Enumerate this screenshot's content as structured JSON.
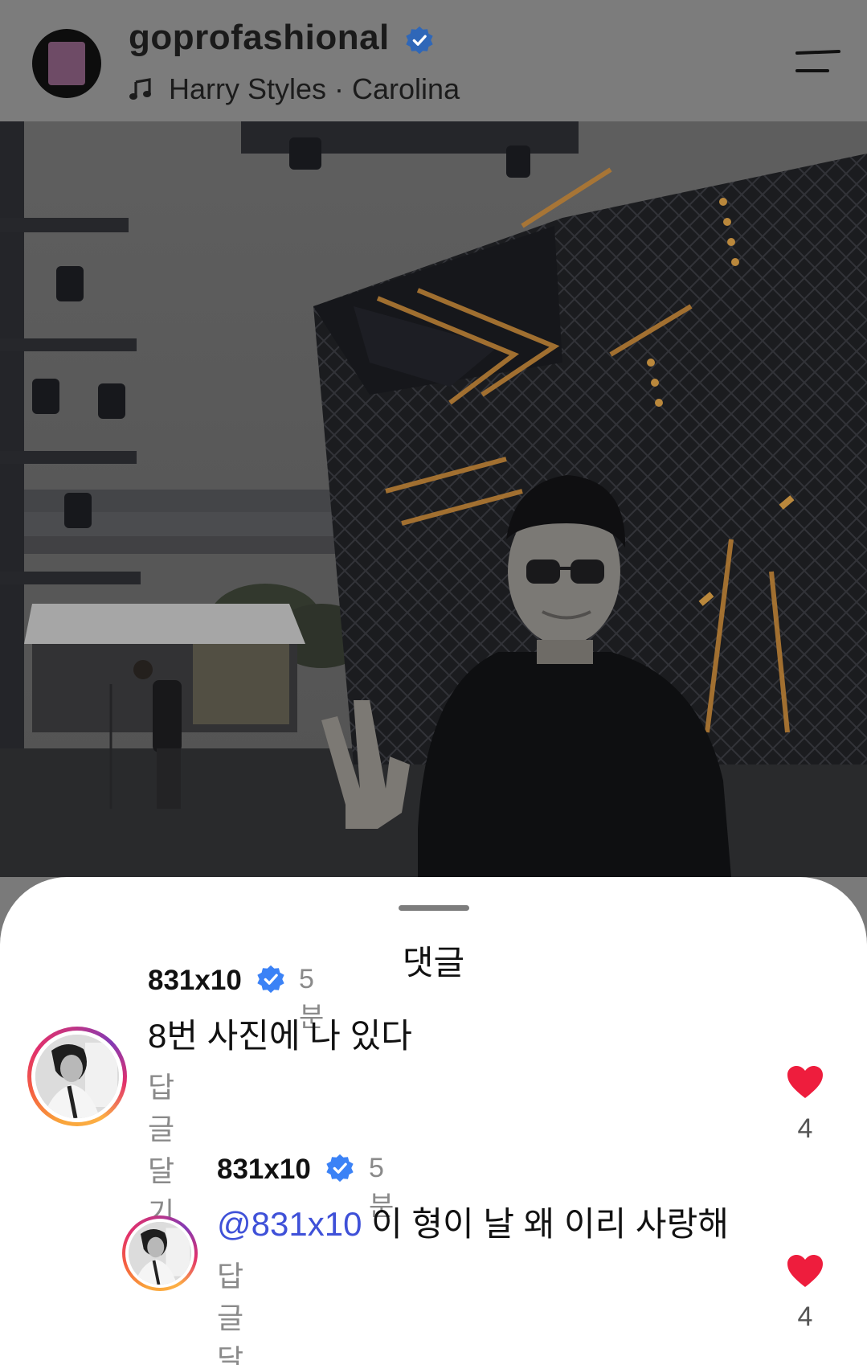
{
  "header": {
    "username": "goprofashional",
    "music": "Harry Styles · Carolina",
    "icons": {
      "verified": "verified-badge-icon",
      "music": "music-note-icon",
      "menu": "menu-icon"
    }
  },
  "sheet": {
    "title": "댓글"
  },
  "comments": [
    {
      "username": "831x10",
      "time": "5분",
      "text": "8번 사진에 나 있다",
      "reply_label": "답글 달기",
      "likes": "4"
    },
    {
      "username": "831x10",
      "time": "5분",
      "mention": "@831x10",
      "text": " 이 형이 날 왜 이리 사랑해",
      "reply_label": "답글 달기",
      "likes": "4"
    }
  ],
  "colors": {
    "verified": "#3b82f6",
    "heart": "#ee1d3d",
    "mention": "#3f51d8",
    "header_bg": "#7c7c7c"
  }
}
